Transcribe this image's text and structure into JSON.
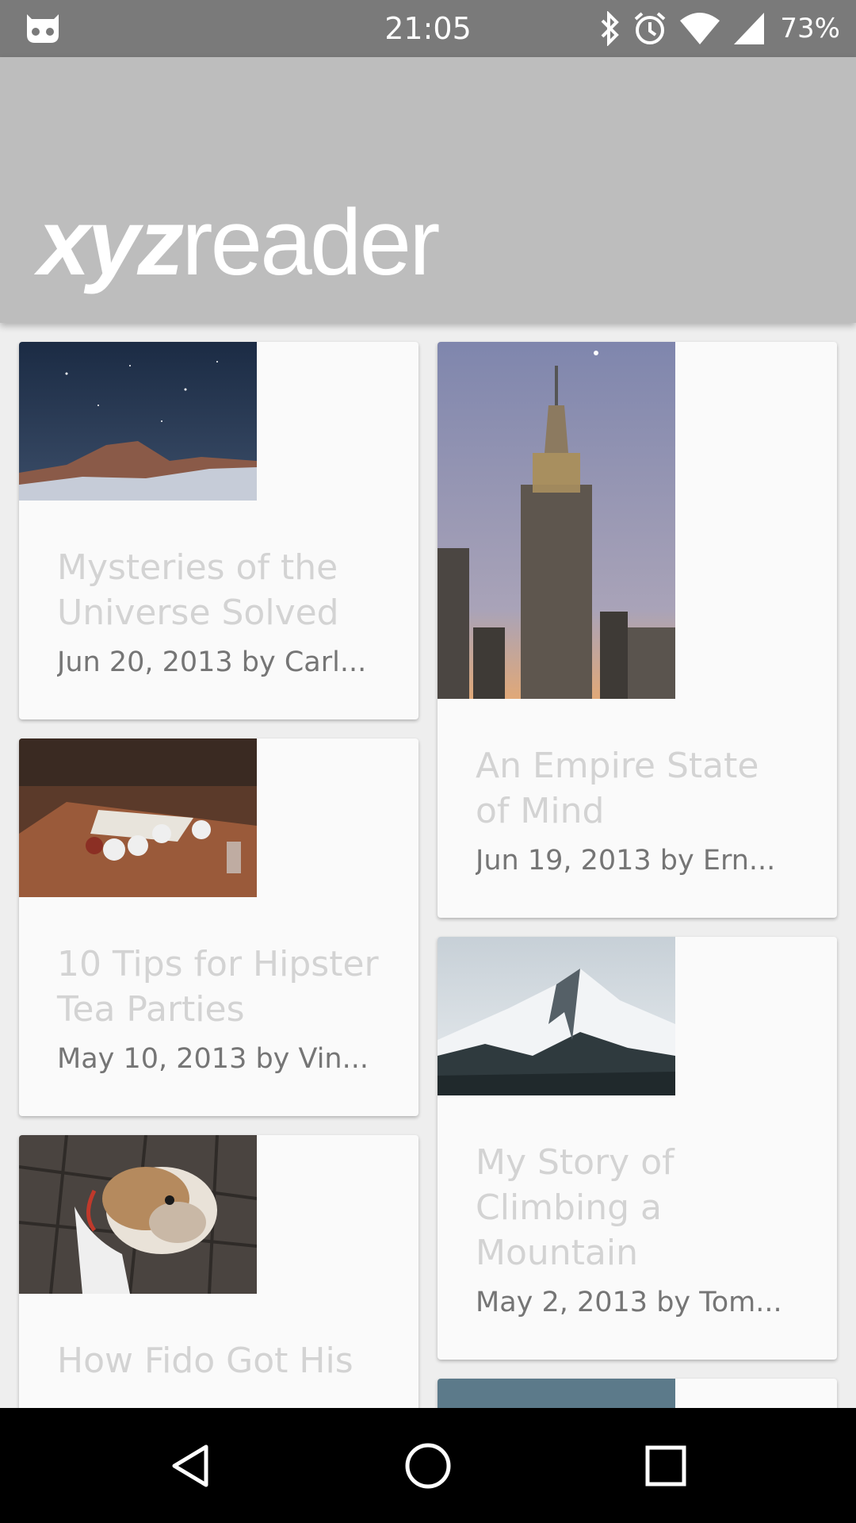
{
  "status_bar": {
    "time": "21:05",
    "battery": "73%",
    "icons": [
      "app-notification-icon",
      "bluetooth-icon",
      "alarm-icon",
      "wifi-icon",
      "signal-icon"
    ]
  },
  "app_bar": {
    "logo_bold": "xyz",
    "logo_light": "reader"
  },
  "articles": [
    {
      "title": "Mysteries of the Universe Solved",
      "meta": "Jun 20, 2013 by Carl..."
    },
    {
      "title": "An Empire State of Mind",
      "meta": "Jun 19, 2013 by Ern..."
    },
    {
      "title": "10 Tips for Hipster Tea Parties",
      "meta": "May 10, 2013 by Vin..."
    },
    {
      "title": "My Story of Climbing a Mountain",
      "meta": "May 2, 2013 by Tom..."
    },
    {
      "title": "How Fido Got His",
      "meta": ""
    }
  ],
  "nav": [
    "back-icon",
    "home-icon",
    "recents-icon"
  ]
}
